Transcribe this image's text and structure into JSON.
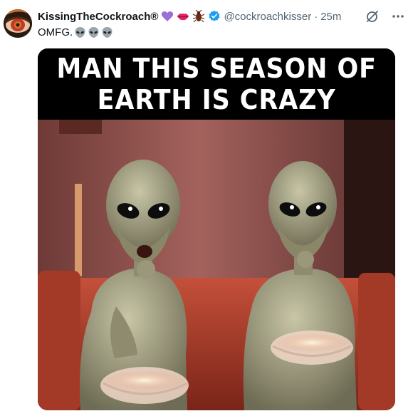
{
  "tweet": {
    "display_name": "KissingTheCockroach®",
    "handle": "@cockroachkisser",
    "separator": "·",
    "time": "25m",
    "text": "OMFG.",
    "name_emojis": [
      "purple-heart",
      "kiss-lips",
      "cockroach"
    ],
    "text_emojis": [
      "alien",
      "alien",
      "alien"
    ]
  },
  "media": {
    "caption_lines": [
      "MAN THIS SEASON OF",
      "EARTH IS CRAZY"
    ]
  },
  "actions": {
    "grok_icon": "slash-circle-icon",
    "more_icon": "ellipsis-icon"
  },
  "colors": {
    "verified_blue": "#1d9bf0",
    "text_secondary": "#536471",
    "purple_heart": "#9b6fd6"
  }
}
